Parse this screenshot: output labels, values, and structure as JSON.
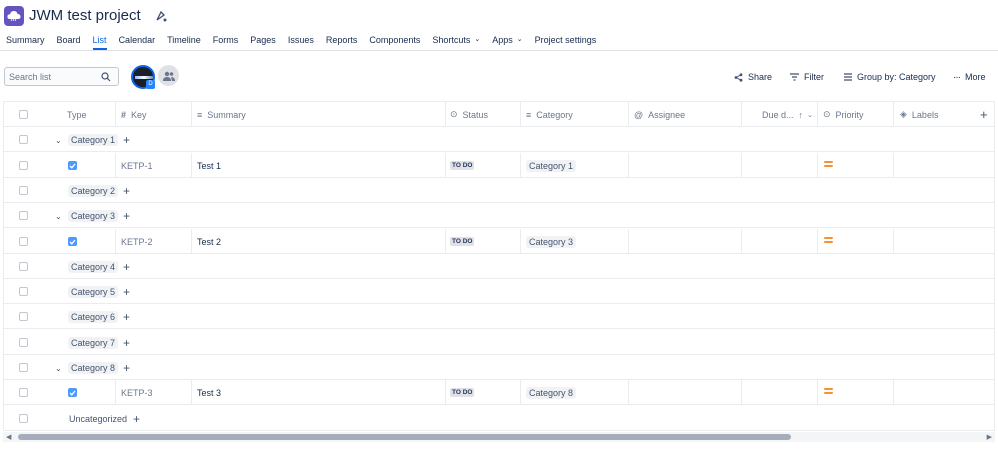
{
  "project": {
    "title": "JWM test project",
    "icon": "cloud-project-icon"
  },
  "nav": [
    {
      "label": "Summary"
    },
    {
      "label": "Board"
    },
    {
      "label": "List",
      "active": true
    },
    {
      "label": "Calendar"
    },
    {
      "label": "Timeline"
    },
    {
      "label": "Forms"
    },
    {
      "label": "Pages"
    },
    {
      "label": "Issues"
    },
    {
      "label": "Reports"
    },
    {
      "label": "Components"
    },
    {
      "label": "Shortcuts",
      "dropdown": true
    },
    {
      "label": "Apps",
      "dropdown": true
    },
    {
      "label": "Project settings"
    }
  ],
  "search": {
    "placeholder": "Search list"
  },
  "avatar_badge": "D",
  "toolbar": {
    "share": "Share",
    "filter": "Filter",
    "group_by": "Group by: Category",
    "more": "More"
  },
  "columns": {
    "type": "Type",
    "key": "Key",
    "summary": "Summary",
    "status": "Status",
    "category": "Category",
    "assignee": "Assignee",
    "due": "Due d...",
    "priority": "Priority",
    "labels": "Labels"
  },
  "rows": [
    {
      "kind": "group",
      "label": "Category 1",
      "expanded": true
    },
    {
      "kind": "issue",
      "key": "KETP-1",
      "summary": "Test 1",
      "status": "TO DO",
      "category": "Category 1",
      "priority": "medium"
    },
    {
      "kind": "group",
      "label": "Category 2",
      "expanded": false
    },
    {
      "kind": "group",
      "label": "Category 3",
      "expanded": true
    },
    {
      "kind": "issue",
      "key": "KETP-2",
      "summary": "Test 2",
      "status": "TO DO",
      "category": "Category 3",
      "priority": "medium"
    },
    {
      "kind": "group",
      "label": "Category 4",
      "expanded": false
    },
    {
      "kind": "group",
      "label": "Category 5",
      "expanded": false
    },
    {
      "kind": "group",
      "label": "Category 6",
      "expanded": false
    },
    {
      "kind": "group",
      "label": "Category 7",
      "expanded": false
    },
    {
      "kind": "group",
      "label": "Category 8",
      "expanded": true
    },
    {
      "kind": "issue",
      "key": "KETP-3",
      "summary": "Test 3",
      "status": "TO DO",
      "category": "Category 8",
      "priority": "medium"
    },
    {
      "kind": "group",
      "label": "Uncategorized",
      "expanded": false,
      "plain": true
    }
  ],
  "colors": {
    "accent": "#0c66e4",
    "priority_medium": "#f79233",
    "task_checkbox": "#4c9aff"
  }
}
